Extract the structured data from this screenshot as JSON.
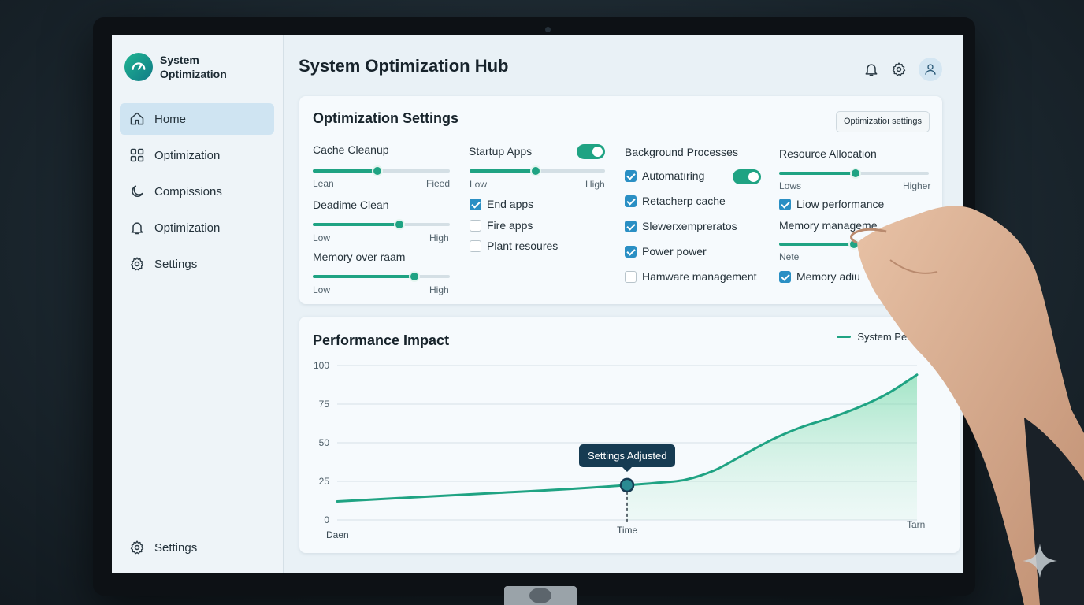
{
  "app": {
    "name": "System Optimization"
  },
  "sidebar": {
    "items": [
      {
        "label": "Home",
        "icon": "home-icon",
        "active": true
      },
      {
        "label": "Optimization",
        "icon": "grid-icon"
      },
      {
        "label": "Compissions",
        "icon": "moon-icon"
      },
      {
        "label": "Optimization",
        "icon": "bell-icon"
      },
      {
        "label": "Settings",
        "icon": "gear-icon"
      }
    ],
    "bottom": {
      "label": "Settings",
      "icon": "gear-icon"
    }
  },
  "header": {
    "title": "System Optimization Hub",
    "icons": [
      "bell-icon",
      "gear-icon",
      "user-avatar-icon"
    ]
  },
  "settings_card": {
    "title": "Optimization Settings",
    "button": "Optimizatioı settings",
    "col1": {
      "cache": {
        "label": "Cache Cleanup",
        "min": "Lean",
        "max": "Fieed",
        "value": 0.47
      },
      "deadime": {
        "label": "Deadime Clean",
        "min": "Low",
        "max": "High",
        "value": 0.63
      },
      "memory": {
        "label": "Memory over raam",
        "min": "Low",
        "max": "High",
        "value": 0.74
      }
    },
    "col2": {
      "title": "Startup Apps",
      "toggle_on": true,
      "slider": {
        "min": "Low",
        "max": "High",
        "value": 0.49
      },
      "checks": [
        {
          "label": "End apps",
          "checked": true
        },
        {
          "label": "Fire apps",
          "checked": false
        },
        {
          "label": "Plant resoures",
          "checked": false
        }
      ]
    },
    "col3": {
      "title": "Background Processes",
      "checks": [
        {
          "label": "Automatıring",
          "checked": true,
          "toggle": true
        },
        {
          "label": "Retacherp cache",
          "checked": true
        },
        {
          "label": "Slewerхempreratoѕ",
          "checked": true
        },
        {
          "label": "Power power",
          "checked": true
        },
        {
          "label": "Hamware management",
          "checked": false
        }
      ]
    },
    "col4": {
      "title": "Resource Allocation",
      "slider": {
        "min": "Lows",
        "max": "Higher",
        "value": 0.51
      },
      "check1": {
        "label": "Liow performance",
        "checked": true
      },
      "memory_label": "Memory manageme",
      "memory_slider": {
        "min": "Nete",
        "value": 0.5
      },
      "check2": {
        "label": "Memory adiu",
        "checked": true
      }
    }
  },
  "perf_card": {
    "title": "Performance Impact",
    "legend": "System Performan",
    "tooltip": "Settings Adjusted",
    "x_labels": {
      "start": "Daen",
      "mid": "Time",
      "end": "Tarn"
    }
  },
  "chart_data": {
    "type": "area",
    "title": "Performance Impact",
    "series": [
      {
        "name": "System Performan",
        "x": [
          0,
          0.1,
          0.2,
          0.3,
          0.4,
          0.5,
          0.55,
          0.6,
          0.65,
          0.7,
          0.75,
          0.8,
          0.85,
          0.9,
          0.95,
          1.0
        ],
        "values": [
          12,
          14,
          16,
          18,
          20,
          22.5,
          24,
          26,
          32,
          42,
          52,
          60,
          66,
          73,
          82,
          94
        ]
      }
    ],
    "yticks": [
      0,
      25,
      50,
      75,
      100
    ],
    "ylim": [
      0,
      100
    ],
    "highlight": {
      "x": 0.5,
      "y": 22.5,
      "label": "Settings Adjusted"
    },
    "shaded_from_x": 0.5,
    "grid": true,
    "legend_position": "top-right",
    "color": "#1fa383"
  }
}
